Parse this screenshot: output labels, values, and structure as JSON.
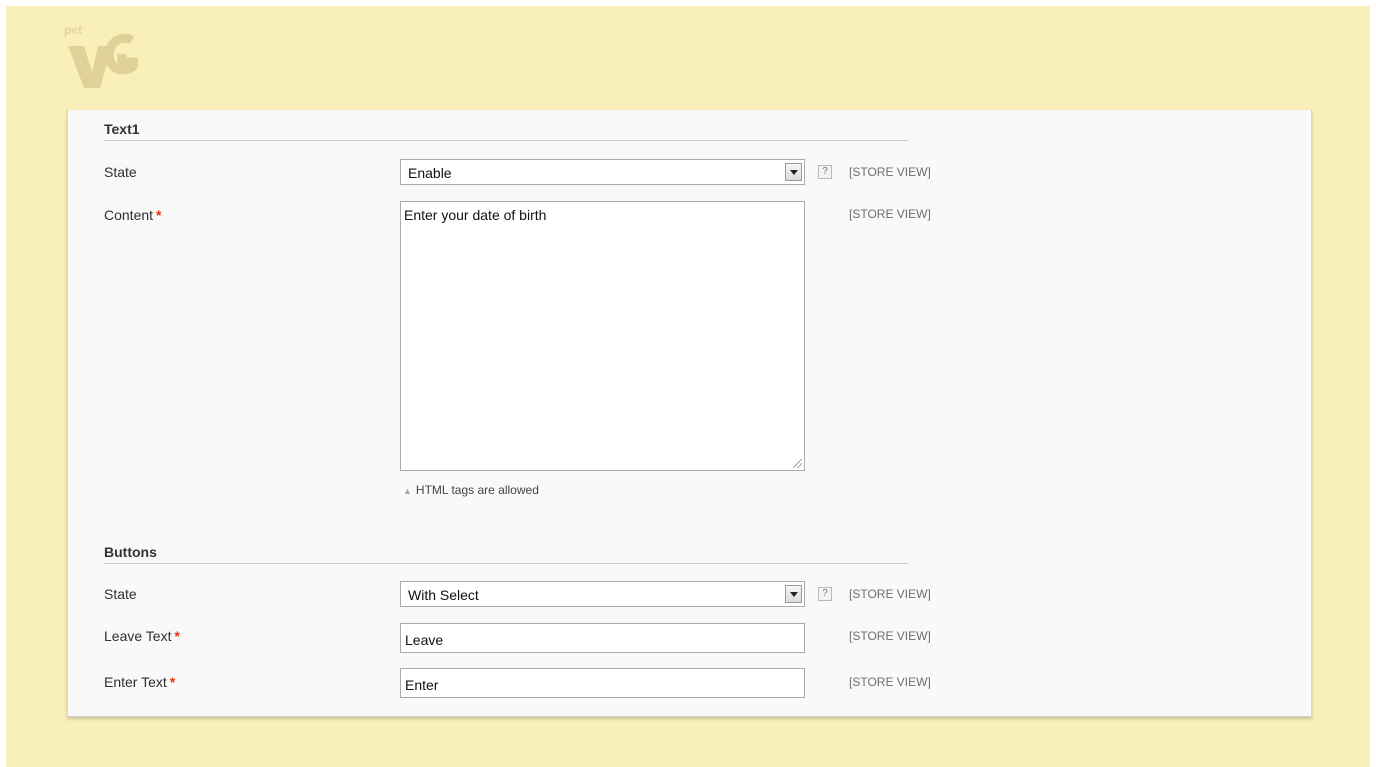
{
  "branding": {
    "logo_icon": "plumrocket-logo-icon",
    "logo_text": "pet VG"
  },
  "sections": {
    "text1": {
      "title": "Text1",
      "state_label": "State",
      "state_value": "Enable",
      "state_scope": "[STORE VIEW]",
      "content_label": "Content",
      "content_required": "*",
      "content_value": "Enter your date of birth",
      "content_scope": "[STORE VIEW]",
      "content_note": "HTML tags are allowed"
    },
    "buttons": {
      "title": "Buttons",
      "state_label": "State",
      "state_value": "With Select",
      "state_scope": "[STORE VIEW]",
      "leave_label": "Leave Text",
      "leave_required": "*",
      "leave_value": "Leave",
      "leave_scope": "[STORE VIEW]",
      "enter_label": "Enter Text",
      "enter_required": "*",
      "enter_value": "Enter",
      "enter_scope": "[STORE VIEW]"
    }
  },
  "help_icon_text": "?",
  "colors": {
    "page_bg": "#f9efb8",
    "panel_bg": "#f9f9f9",
    "required": "#eb340a"
  }
}
